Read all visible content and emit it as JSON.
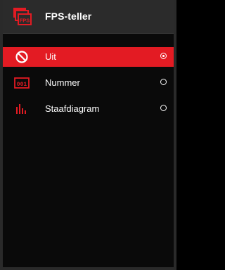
{
  "header": {
    "title": "FPS-teller",
    "icon": "fps-counter-icon",
    "icon_text": "FPS"
  },
  "menu": {
    "items": [
      {
        "label": "Uit",
        "icon": "prohibited-icon",
        "selected": true
      },
      {
        "label": "Nummer",
        "icon": "number-001-icon",
        "icon_text": "001",
        "selected": false
      },
      {
        "label": "Staafdiagram",
        "icon": "bar-chart-icon",
        "selected": false
      }
    ]
  },
  "colors": {
    "accent": "#e31b23",
    "header_bg": "#2b2b2b",
    "panel_bg": "#0a0a0a",
    "text": "#ffffff"
  }
}
